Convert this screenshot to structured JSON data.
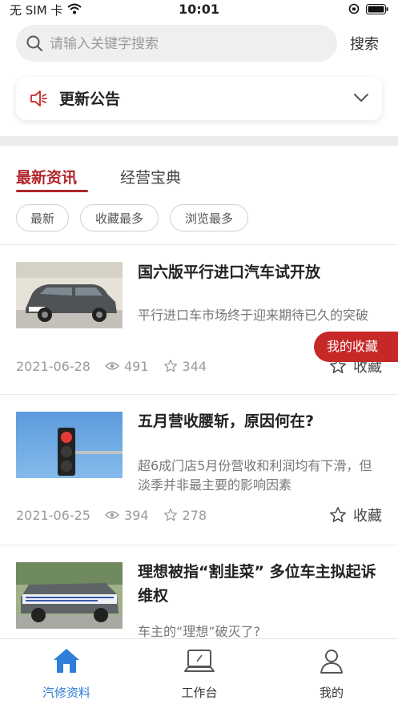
{
  "status_bar": {
    "carrier": "无 SIM 卡",
    "time": "10:01"
  },
  "search": {
    "placeholder": "请输入关键字搜索",
    "button_label": "搜索"
  },
  "notice": {
    "title": "更新公告"
  },
  "tabs": [
    {
      "label": "最新资讯",
      "active": true
    },
    {
      "label": "经营宝典",
      "active": false
    }
  ],
  "filters": [
    "最新",
    "收藏最多",
    "浏览最多"
  ],
  "articles": [
    {
      "title": "国六版平行进口汽车试开放",
      "desc": "平行进口车市场终于迎来期待已久的突破",
      "date": "2021-06-28",
      "views": "491",
      "stars": "344",
      "collect_label": "收藏"
    },
    {
      "title": "五月营收腰斩，原因何在?",
      "desc": "超6成门店5月份营收和利润均有下滑，但淡季并非最主要的影响因素",
      "date": "2021-06-25",
      "views": "394",
      "stars": "278",
      "collect_label": "收藏"
    },
    {
      "title": "理想被指“割韭菜” 多位车主拟起诉维权",
      "desc": "车主的“理想”破灭了?",
      "date": "",
      "views": "",
      "stars": "",
      "collect_label": ""
    }
  ],
  "floating_button": {
    "label": "我的收藏"
  },
  "tabbar": [
    {
      "label": "汽修资料",
      "icon": "home-icon",
      "active": true
    },
    {
      "label": "工作台",
      "icon": "laptop-icon",
      "active": false
    },
    {
      "label": "我的",
      "icon": "user-icon",
      "active": false
    }
  ],
  "colors": {
    "accent_red": "#b1262b",
    "floating_red": "#c62828",
    "tab_blue": "#2f7ed8"
  }
}
